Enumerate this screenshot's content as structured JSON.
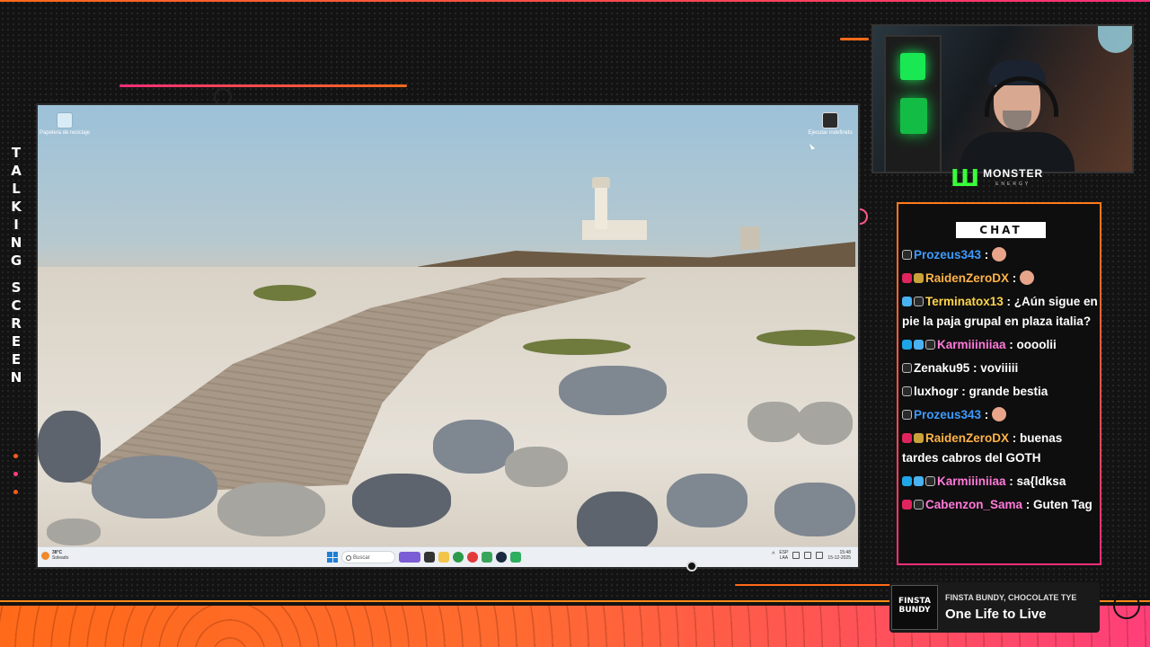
{
  "overlay": {
    "vertical_text": "TALKING SCREEN",
    "colors": {
      "accent_orange": "#ff6a1a",
      "accent_pink": "#ff2e7a",
      "background": "#131313"
    }
  },
  "desktop": {
    "icons": [
      {
        "label": "Papelera de reciclaje",
        "icon": "recycle-bin-icon"
      },
      {
        "label": "Ejecutar indefinido",
        "icon": "clock-icon"
      }
    ],
    "taskbar": {
      "weather_temp": "38°C",
      "weather_desc": "Soleado",
      "search_placeholder": "Buscar",
      "lang_top": "ESP",
      "lang_bottom": "LAA",
      "time": "15:48",
      "date": "15-12-2025"
    }
  },
  "sponsor": {
    "name": "MONSTER",
    "sub": "ENERGY"
  },
  "chat": {
    "title": "CHAT",
    "messages": [
      {
        "user": "Prozeus343",
        "text": "",
        "color": "u-blue",
        "emote": true
      },
      {
        "user": "RaidenZeroDX",
        "text": "",
        "color": "u-orange",
        "emote": true
      },
      {
        "user": "Terminatox13",
        "text": "¿Aún sigue en pie la paja grupal en plaza italia?",
        "color": "u-yellow",
        "emote": false
      },
      {
        "user": "Karmiiiniiaa",
        "text": "oooolii",
        "color": "u-pink",
        "emote": false
      },
      {
        "user": "Zenaku95",
        "text": "voviiiii",
        "color": "u-white",
        "emote": false
      },
      {
        "user": "luxhogr",
        "text": "grande bestia",
        "color": "u-white",
        "emote": false
      },
      {
        "user": "Prozeus343",
        "text": "",
        "color": "u-blue",
        "emote": true
      },
      {
        "user": "RaidenZeroDX",
        "text": "buenas tardes cabros del GOTH",
        "color": "u-orange",
        "emote": false
      },
      {
        "user": "Karmiiiniiaa",
        "text": "sa{ldksa",
        "color": "u-pink",
        "emote": false
      },
      {
        "user": "Cabenzon_Sama",
        "text": "Guten Tag",
        "color": "u-pink",
        "emote": false
      }
    ]
  },
  "now_playing": {
    "artist": "FINSTA BUNDY, CHOCOLATE TYE",
    "title": "One Life to Live",
    "art_text": "FINSTA BUNDY"
  }
}
